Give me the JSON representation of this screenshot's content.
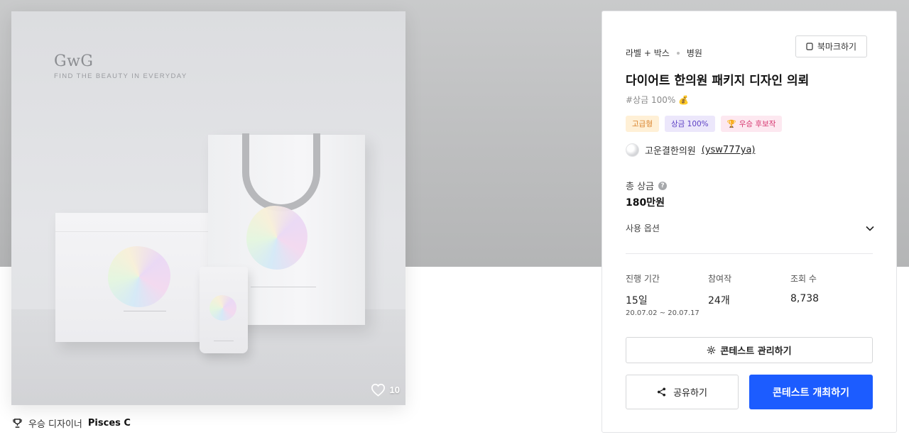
{
  "hero": {
    "brand_logo": "GwG",
    "brand_tagline": "FIND THE BEAUTY IN EVERYDAY",
    "likes_count": "10",
    "like_icon": "heart-outline-icon"
  },
  "winner": {
    "label": "우승 디자이너",
    "name": "Pisces C",
    "icon": "trophy-icon"
  },
  "panel": {
    "breadcrumb": {
      "category": "라벨 + 박스",
      "subcategory": "병원"
    },
    "bookmark_label": "북마크하기",
    "title": "다이어트 한의원 패키지 디자인 의뢰",
    "hashtag": "#상금 100%",
    "hashtag_icon": "money-bag-icon",
    "badges": {
      "premium": "고급형",
      "prize": "상금 100%",
      "winner": "우승 후보작"
    },
    "host": {
      "name": "고운결한의원",
      "user_id": "(ysw777ya)"
    },
    "prize_label": "총 상금",
    "prize_help": "?",
    "prize_value": "180만원",
    "usage_label": "사용 옵션",
    "stats": {
      "duration_label": "진행 기간",
      "duration_value": "15일",
      "duration_range": "20.07.02 ~ 20.07.17",
      "entries_label": "참여작",
      "entries_value": "24개",
      "views_label": "조회 수",
      "views_value": "8,738"
    },
    "manage_label": "콘테스트 관리하기",
    "share_label": "공유하기",
    "host_contest_label": "콘테스트 개최하기"
  },
  "colors": {
    "primary": "#1c5cff",
    "badge_premium_bg": "#fff0d6",
    "badge_prize_bg": "#ece7fb",
    "badge_winner_bg": "#fde8f0"
  }
}
